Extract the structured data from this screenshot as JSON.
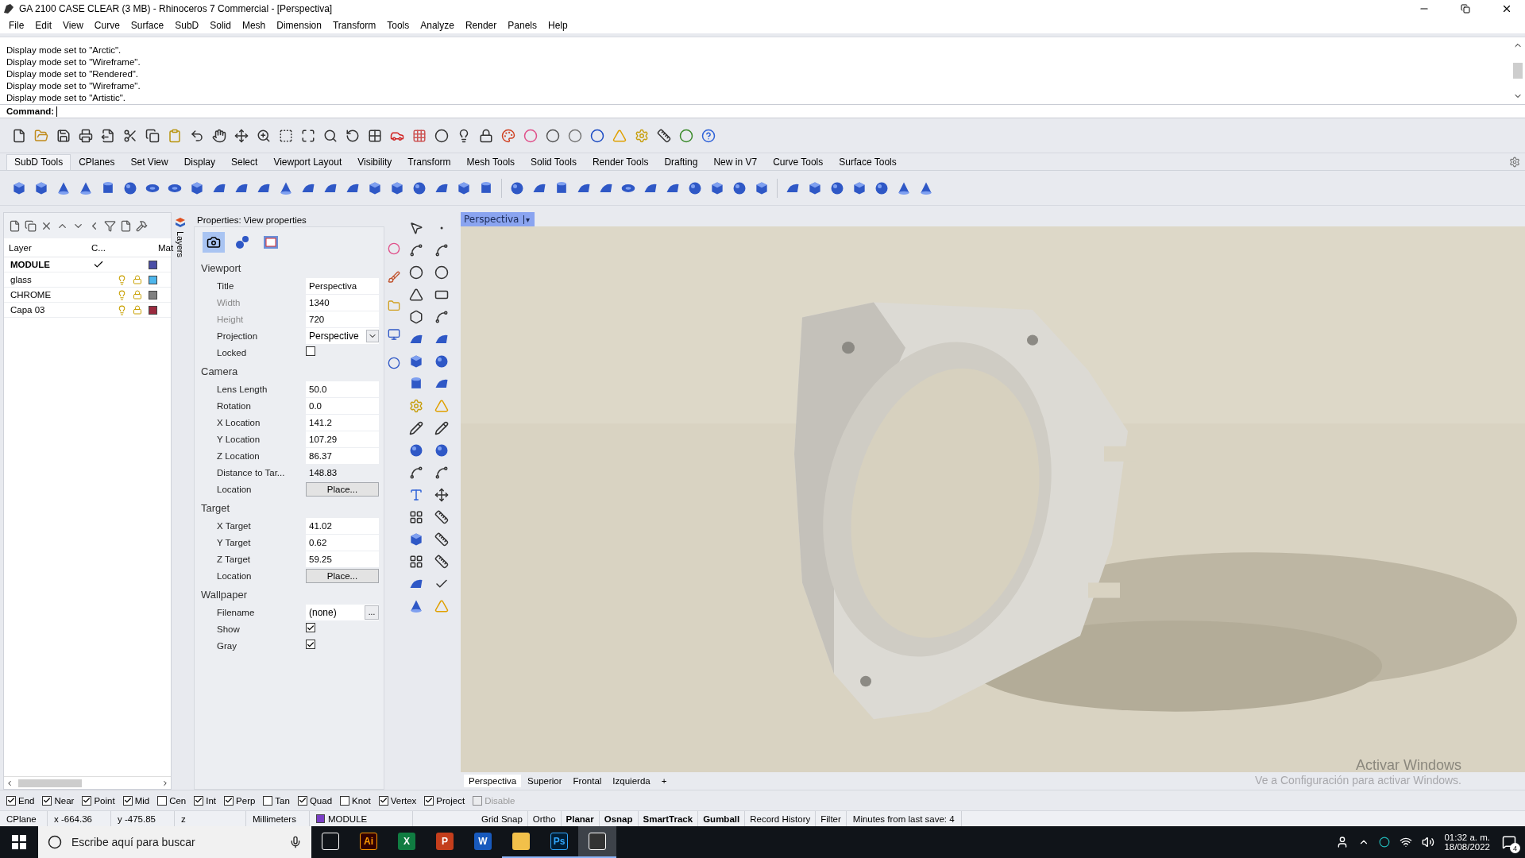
{
  "window": {
    "title": "GA 2100 CASE CLEAR (3 MB) - Rhinoceros 7 Commercial - [Perspectiva]"
  },
  "menu": [
    "File",
    "Edit",
    "View",
    "Curve",
    "Surface",
    "SubD",
    "Solid",
    "Mesh",
    "Dimension",
    "Transform",
    "Tools",
    "Analyze",
    "Render",
    "Panels",
    "Help"
  ],
  "command_history": [
    "Display mode set to \"Arctic\".",
    "Display mode set to \"Wireframe\".",
    "Display mode set to \"Rendered\".",
    "Display mode set to \"Wireframe\".",
    "Display mode set to \"Artistic\"."
  ],
  "command": {
    "label": "Command:"
  },
  "toolbar_tabs": [
    {
      "label": "SubD Tools",
      "selected": true
    },
    {
      "label": "CPlanes",
      "selected": false
    },
    {
      "label": "Set View",
      "selected": false
    },
    {
      "label": "Display",
      "selected": false
    },
    {
      "label": "Select",
      "selected": false
    },
    {
      "label": "Viewport Layout",
      "selected": false
    },
    {
      "label": "Visibility",
      "selected": false
    },
    {
      "label": "Transform",
      "selected": false
    },
    {
      "label": "Mesh Tools",
      "selected": false
    },
    {
      "label": "Solid Tools",
      "selected": false
    },
    {
      "label": "Render Tools",
      "selected": false
    },
    {
      "label": "Drafting",
      "selected": false
    },
    {
      "label": "New in V7",
      "selected": false
    },
    {
      "label": "Curve Tools",
      "selected": false
    },
    {
      "label": "Surface Tools",
      "selected": false
    }
  ],
  "layers": {
    "tab": "Layers",
    "columns": [
      "Layer",
      "C...",
      "Mat"
    ],
    "rows": [
      {
        "name": "MODULE",
        "current": true,
        "color": "#4a4ea6"
      },
      {
        "name": "glass",
        "current": false,
        "color": "#4db6ec"
      },
      {
        "name": "CHROME",
        "current": false,
        "color": "#808080"
      },
      {
        "name": "Capa 03",
        "current": false,
        "color": "#9b2b3f"
      }
    ]
  },
  "properties": {
    "title": "Properties: View properties",
    "sections": [
      {
        "heading": "Viewport",
        "rows": [
          {
            "kind": "text",
            "label": "Title",
            "value": "Perspectiva",
            "disabled": false
          },
          {
            "kind": "text",
            "label": "Width",
            "value": "1340",
            "disabled": true
          },
          {
            "kind": "text",
            "label": "Height",
            "value": "720",
            "disabled": true
          },
          {
            "kind": "dropdown",
            "label": "Projection",
            "value": "Perspective",
            "disabled": false
          },
          {
            "kind": "checkbox",
            "label": "Locked",
            "checked": false,
            "disabled": false
          }
        ]
      },
      {
        "heading": "Camera",
        "rows": [
          {
            "kind": "text",
            "label": "Lens Length",
            "value": "50.0",
            "disabled": false
          },
          {
            "kind": "text",
            "label": "Rotation",
            "value": "0.0",
            "disabled": false
          },
          {
            "kind": "text",
            "label": "X Location",
            "value": "141.2",
            "disabled": false
          },
          {
            "kind": "text",
            "label": "Y Location",
            "value": "107.29",
            "disabled": false
          },
          {
            "kind": "text",
            "label": "Z Location",
            "value": "86.37",
            "disabled": false
          },
          {
            "kind": "readonly",
            "label": "Distance to Tar...",
            "value": "148.83",
            "disabled": false
          },
          {
            "kind": "button",
            "label": "Location",
            "value": "Place...",
            "disabled": false
          }
        ]
      },
      {
        "heading": "Target",
        "rows": [
          {
            "kind": "text",
            "label": "X Target",
            "value": "41.02",
            "disabled": false
          },
          {
            "kind": "text",
            "label": "Y Target",
            "value": "0.62",
            "disabled": false
          },
          {
            "kind": "text",
            "label": "Z Target",
            "value": "59.25",
            "disabled": false
          },
          {
            "kind": "button",
            "label": "Location",
            "value": "Place...",
            "disabled": false
          }
        ]
      },
      {
        "heading": "Wallpaper",
        "rows": [
          {
            "kind": "file",
            "label": "Filename",
            "value": "(none)",
            "button": "...",
            "disabled": false
          },
          {
            "kind": "checkbox",
            "label": "Show",
            "checked": true,
            "disabled": false
          },
          {
            "kind": "checkbox",
            "label": "Gray",
            "checked": true,
            "disabled": false
          }
        ]
      }
    ]
  },
  "viewport": {
    "tab": "Perspectiva",
    "tab_menu": "▾",
    "bottom_tabs": [
      {
        "label": "Perspectiva",
        "selected": true
      },
      {
        "label": "Superior",
        "selected": false
      },
      {
        "label": "Frontal",
        "selected": false
      },
      {
        "label": "Izquierda",
        "selected": false
      }
    ],
    "add_tab": "+"
  },
  "activation": {
    "title": "Activar Windows",
    "message": "Ve a Configuración para activar Windows."
  },
  "osnaps": [
    {
      "label": "End",
      "checked": true,
      "disabled": false
    },
    {
      "label": "Near",
      "checked": true,
      "disabled": false
    },
    {
      "label": "Point",
      "checked": true,
      "disabled": false
    },
    {
      "label": "Mid",
      "checked": true,
      "disabled": false
    },
    {
      "label": "Cen",
      "checked": false,
      "disabled": false
    },
    {
      "label": "Int",
      "checked": true,
      "disabled": false
    },
    {
      "label": "Perp",
      "checked": true,
      "disabled": false
    },
    {
      "label": "Tan",
      "checked": false,
      "disabled": false
    },
    {
      "label": "Quad",
      "checked": true,
      "disabled": false
    },
    {
      "label": "Knot",
      "checked": false,
      "disabled": false
    },
    {
      "label": "Vertex",
      "checked": true,
      "disabled": false
    },
    {
      "label": "Project",
      "checked": true,
      "disabled": false
    },
    {
      "label": "Disable",
      "checked": false,
      "disabled": true
    }
  ],
  "status_bar": {
    "cplane": "CPlane",
    "x": "x -664.36",
    "y": "y -475.85",
    "z": "z",
    "units": "Millimeters",
    "layer": "MODULE",
    "toggles": [
      {
        "label": "Grid Snap",
        "on": false
      },
      {
        "label": "Ortho",
        "on": false
      },
      {
        "label": "Planar",
        "on": true
      },
      {
        "label": "Osnap",
        "on": true
      },
      {
        "label": "SmartTrack",
        "on": true
      },
      {
        "label": "Gumball",
        "on": true
      },
      {
        "label": "Record History",
        "on": false
      },
      {
        "label": "Filter",
        "on": false
      }
    ],
    "message": "Minutes from last save: 4"
  },
  "taskbar": {
    "search_placeholder": "Escribe aquí para buscar",
    "apps": [
      {
        "kind": "taskview",
        "running": false,
        "selected": false
      },
      {
        "kind": "illustrator",
        "label": "Ai",
        "running": false,
        "selected": false
      },
      {
        "kind": "excel",
        "label": "X",
        "running": false,
        "selected": false
      },
      {
        "kind": "powerpoint",
        "label": "P",
        "running": false,
        "selected": false
      },
      {
        "kind": "word",
        "label": "W",
        "running": false,
        "selected": false
      },
      {
        "kind": "explorer",
        "running": true,
        "selected": false
      },
      {
        "kind": "photoshop",
        "label": "Ps",
        "running": true,
        "selected": false
      },
      {
        "kind": "rhino",
        "running": true,
        "selected": true
      }
    ],
    "time": "01:32 a. m.",
    "date": "18/08/2022",
    "notifications": "4"
  }
}
